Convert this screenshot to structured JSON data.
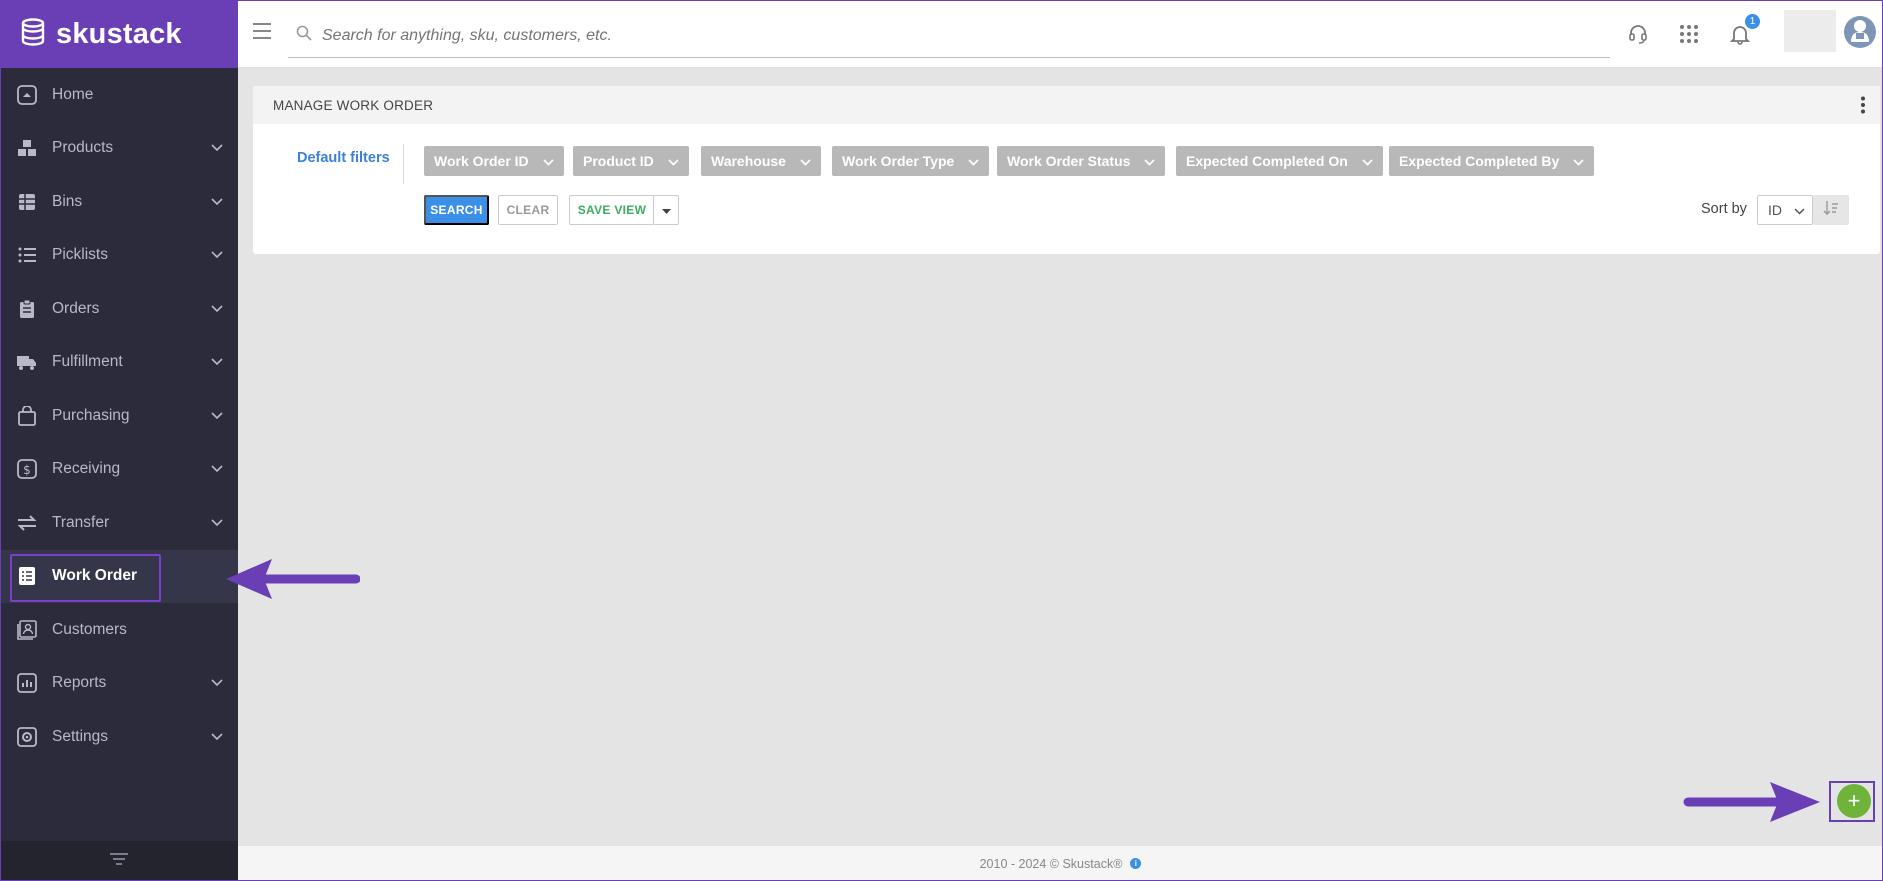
{
  "brand": {
    "name": "skustack"
  },
  "sidebar": {
    "items": [
      {
        "label": "Home",
        "icon": "home-icon",
        "chevron": false
      },
      {
        "label": "Products",
        "icon": "products-icon",
        "chevron": true
      },
      {
        "label": "Bins",
        "icon": "bins-icon",
        "chevron": true
      },
      {
        "label": "Picklists",
        "icon": "list-icon",
        "chevron": true
      },
      {
        "label": "Orders",
        "icon": "clipboard-icon",
        "chevron": true
      },
      {
        "label": "Fulfillment",
        "icon": "truck-icon",
        "chevron": true
      },
      {
        "label": "Purchasing",
        "icon": "bag-icon",
        "chevron": true
      },
      {
        "label": "Receiving",
        "icon": "dollar-icon",
        "chevron": true
      },
      {
        "label": "Transfer",
        "icon": "transfer-icon",
        "chevron": true
      },
      {
        "label": "Work Order",
        "icon": "work-order-icon",
        "chevron": false,
        "active": true
      },
      {
        "label": "Customers",
        "icon": "customers-icon",
        "chevron": false
      },
      {
        "label": "Reports",
        "icon": "reports-icon",
        "chevron": true
      },
      {
        "label": "Settings",
        "icon": "settings-icon",
        "chevron": true
      }
    ]
  },
  "topbar": {
    "search_placeholder": "Search for anything, sku, customers, etc.",
    "notification_count": "1"
  },
  "card": {
    "title": "MANAGE WORK ORDER",
    "default_filters": "Default filters",
    "filters": [
      "Work Order ID",
      "Product ID",
      "Warehouse",
      "Work Order Type",
      "Work Order Status",
      "Expected Completed On",
      "Expected Completed By"
    ],
    "buttons": {
      "search": "SEARCH",
      "clear": "CLEAR",
      "save_view": "SAVE VIEW"
    },
    "sort": {
      "label": "Sort by",
      "value": "ID"
    }
  },
  "footer": {
    "text": "2010 - 2024 © Skustack®"
  },
  "fab": {
    "label": "+"
  },
  "colors": {
    "brand": "#6a3fb5",
    "sidebar": "#2b2b3c",
    "accent": "#3b8fe6",
    "fab": "#6fb33b"
  }
}
